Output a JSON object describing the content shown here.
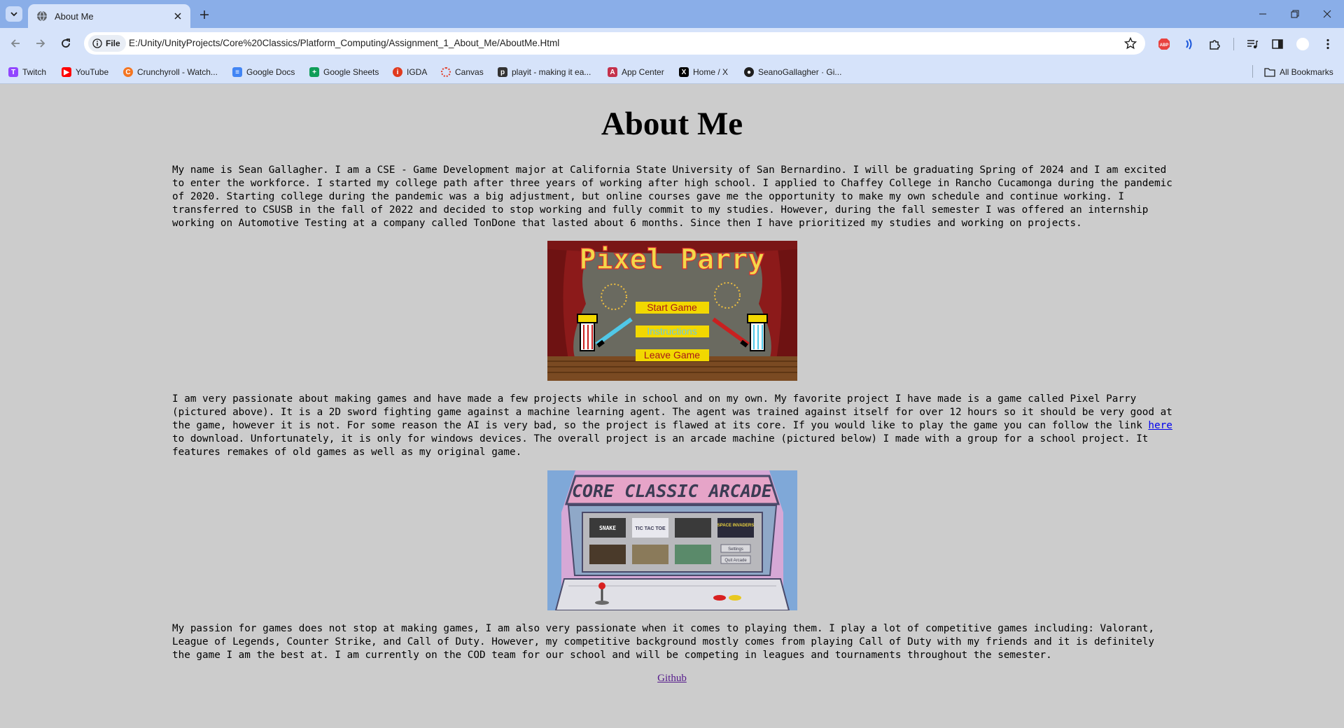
{
  "browser": {
    "tab": {
      "title": "About Me"
    },
    "address": {
      "chip": "File",
      "url": "E:/Unity/UnityProjects/Core%20Classics/Platform_Computing/Assignment_1_About_Me/AboutMe.Html"
    },
    "bookmarks": [
      {
        "label": "Twitch",
        "icon": "twitch-icon",
        "color": "#9146ff"
      },
      {
        "label": "YouTube",
        "icon": "youtube-icon",
        "color": "#ff0000"
      },
      {
        "label": "Crunchyroll - Watch...",
        "icon": "crunchyroll-icon",
        "color": "#f47521"
      },
      {
        "label": "Google Docs",
        "icon": "google-docs-icon",
        "color": "#4285f4"
      },
      {
        "label": "Google Sheets",
        "icon": "google-sheets-icon",
        "color": "#0f9d58"
      },
      {
        "label": "IGDA",
        "icon": "igda-icon",
        "color": "#e03a1e"
      },
      {
        "label": "Canvas",
        "icon": "canvas-icon",
        "color": "#e13f2b"
      },
      {
        "label": "playit - making it ea...",
        "icon": "playit-icon",
        "color": "#333333"
      },
      {
        "label": "App Center",
        "icon": "app-center-icon",
        "color": "#c4314b"
      },
      {
        "label": "Home / X",
        "icon": "x-icon",
        "color": "#000000"
      },
      {
        "label": "SeanoGallagher · Gi...",
        "icon": "github-icon",
        "color": "#1f1f1f"
      }
    ],
    "all_bookmarks": "All Bookmarks"
  },
  "page": {
    "heading": "About Me",
    "para1": "My name is Sean Gallagher. I am a CSE - Game Development major at California State University of San Bernardino. I will be graduating Spring of 2024 and I am excited to enter the workforce. I started my college path after three years of working after high school. I applied to Chaffey College in Rancho Cucamonga during the pandemic of 2020. Starting college during the pandemic was a big adjustment, but online courses gave me the opportunity to make my own schedule and continue working. I transferred to CSUSB in the fall of 2022 and decided to stop working and fully commit to my studies. However, during the fall semester I was offered an internship working on Automotive Testing at a company called TonDone that lasted about 6 months. Since then I have prioritized my studies and working on projects.",
    "pixel_parry": {
      "title": "Pixel Parry",
      "buttons": [
        "Start Game",
        "Instructions",
        "Leave Game"
      ]
    },
    "para2_before": "I am very passionate about making games and have made a few projects while in school and on my own. My favorite project I have made is a game called Pixel Parry (pictured above). It is a 2D sword fighting game against a machine learning agent. The agent was trained against itself for over 12 hours so it should be very good at the game, however it is not. For some reason the AI is very bad, so the project is flawed at its core. If you would like to play the game you can follow the link ",
    "para2_link": "here",
    "para2_after": " to download. Unfortunately, it is only for windows devices. The overall project is an arcade machine (pictured below) I made with a group for a school project. It features remakes of old games as well as my original game.",
    "arcade": {
      "title": "CORE CLASSIC ARCADE",
      "tiles": [
        "SNAKE",
        "TIC TAC TOE",
        "",
        "SPACE INVADERS",
        "",
        "",
        "",
        "Settings",
        "Quit Arcade"
      ]
    },
    "para3": "My passion for games does not stop at making games, I am also very passionate when it comes to playing them. I play a lot of competitive games including: Valorant, League of Legends, Counter Strike, and Call of Duty. However, my competitive background mostly comes from playing Call of Duty with my friends and it is definitely the game I am the best at. I am currently on the COD team for our school and will be competing in leagues and tournaments throughout the semester.",
    "github_link": "Github"
  }
}
